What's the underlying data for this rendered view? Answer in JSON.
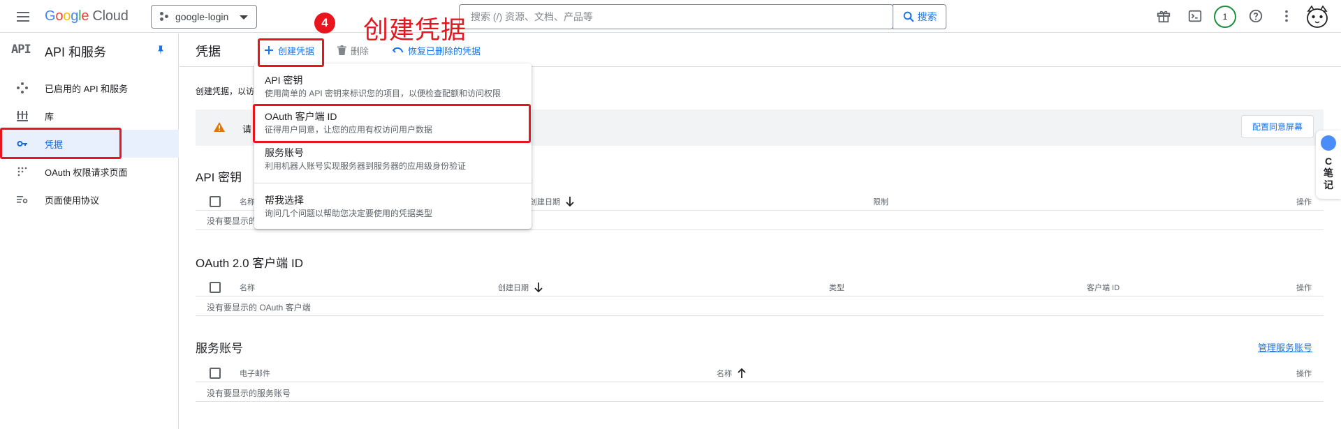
{
  "topbar": {
    "logo_letters": [
      "G",
      "o",
      "o",
      "g",
      "l",
      "e"
    ],
    "logo_suffix": "Cloud",
    "project": "google-login",
    "search_placeholder": "搜索 (/) 资源、文档、产品等",
    "search_button": "搜索",
    "notification_count": "1"
  },
  "sidebar": {
    "api_badge": "API",
    "title": "API 和服务",
    "items": [
      {
        "label": "已启用的 API 和服务",
        "icon": "diamond-dots-icon"
      },
      {
        "label": "库",
        "icon": "library-icon"
      },
      {
        "label": "凭据",
        "icon": "key-icon"
      },
      {
        "label": "OAuth 权限请求页面",
        "icon": "dots-list-icon"
      },
      {
        "label": "页面使用协议",
        "icon": "settings-list-icon"
      }
    ]
  },
  "header": {
    "title": "凭据",
    "create_label": "创建凭据",
    "delete_label": "删除",
    "restore_label": "恢复已删除的凭据"
  },
  "main": {
    "intro_text": "创建凭据，以访",
    "warning_text": "请",
    "config_button": "配置同意屏幕",
    "api_keys": {
      "title": "API 密钥",
      "columns": [
        "名称",
        "创建日期",
        "限制",
        "操作"
      ],
      "empty": "没有要显示的"
    },
    "oauth": {
      "title": "OAuth 2.0 客户端 ID",
      "columns": [
        "名称",
        "创建日期",
        "类型",
        "客户端 ID",
        "操作"
      ],
      "empty": "没有要显示的 OAuth 客户端"
    },
    "service_accounts": {
      "title": "服务账号",
      "manage_link": "管理服务账号",
      "columns": [
        "电子邮件",
        "名称",
        "操作"
      ],
      "empty": "没有要显示的服务账号"
    }
  },
  "dropdown": {
    "items": [
      {
        "title": "API 密钥",
        "desc": "使用简单的 API 密钥来标识您的项目，以便检查配额和访问权限"
      },
      {
        "title": "OAuth 客户端 ID",
        "desc": "征得用户同意，让您的应用有权访问用户数据"
      },
      {
        "title": "服务账号",
        "desc": "利用机器人账号实现服务器到服务器的应用级身份验证"
      },
      {
        "title": "帮我选择",
        "desc": "询问几个问题以帮助您决定要使用的凭据类型"
      }
    ]
  },
  "annotation": {
    "step": "4",
    "label": "创建凭据",
    "color": "#e8151f"
  },
  "note_widget": {
    "text": "C笔记"
  },
  "colors": {
    "accent": "#1a73e8",
    "active_bg": "#e8f0fe",
    "warning": "#e37400"
  }
}
